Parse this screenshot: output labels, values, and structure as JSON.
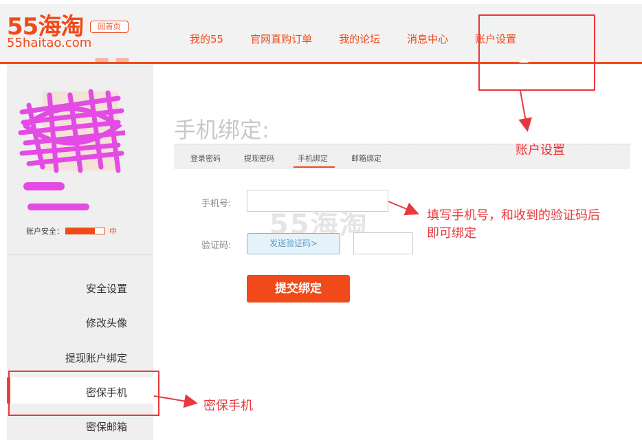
{
  "header": {
    "logo_main": "55海淘",
    "logo_sub": "55haitao.com",
    "home_label": "回首页",
    "nav": [
      "我的55",
      "官网直购订单",
      "我的论坛",
      "消息中心",
      "账户设置"
    ],
    "active_nav": "账户设置"
  },
  "sidebar": {
    "security_label": "账户安全：",
    "security_level": "中",
    "security_fill": 0.75,
    "menu": [
      "安全设置",
      "修改头像",
      "提现账户绑定",
      "密保手机",
      "密保邮箱"
    ],
    "active_menu": "密保手机"
  },
  "main": {
    "title": "手机绑定:",
    "tabs": [
      "登录密码",
      "提现密码",
      "手机绑定",
      "邮箱绑定"
    ],
    "active_tab": "手机绑定",
    "phone_label": "手机号:",
    "phone_value": "",
    "code_label": "验证码:",
    "send_code_label": "发送验证码>",
    "code_value": "",
    "watermark": "55海淘",
    "submit_label": "提交绑定"
  },
  "annotations": {
    "account_settings": "账户设置",
    "fill_phone_line1": "填写手机号，和收到的验证码后",
    "fill_phone_line2": "即可绑定",
    "secure_phone": "密保手机"
  },
  "colors": {
    "accent": "#f04a1a",
    "annotation": "#e8383b",
    "redaction": "#e44be4"
  }
}
